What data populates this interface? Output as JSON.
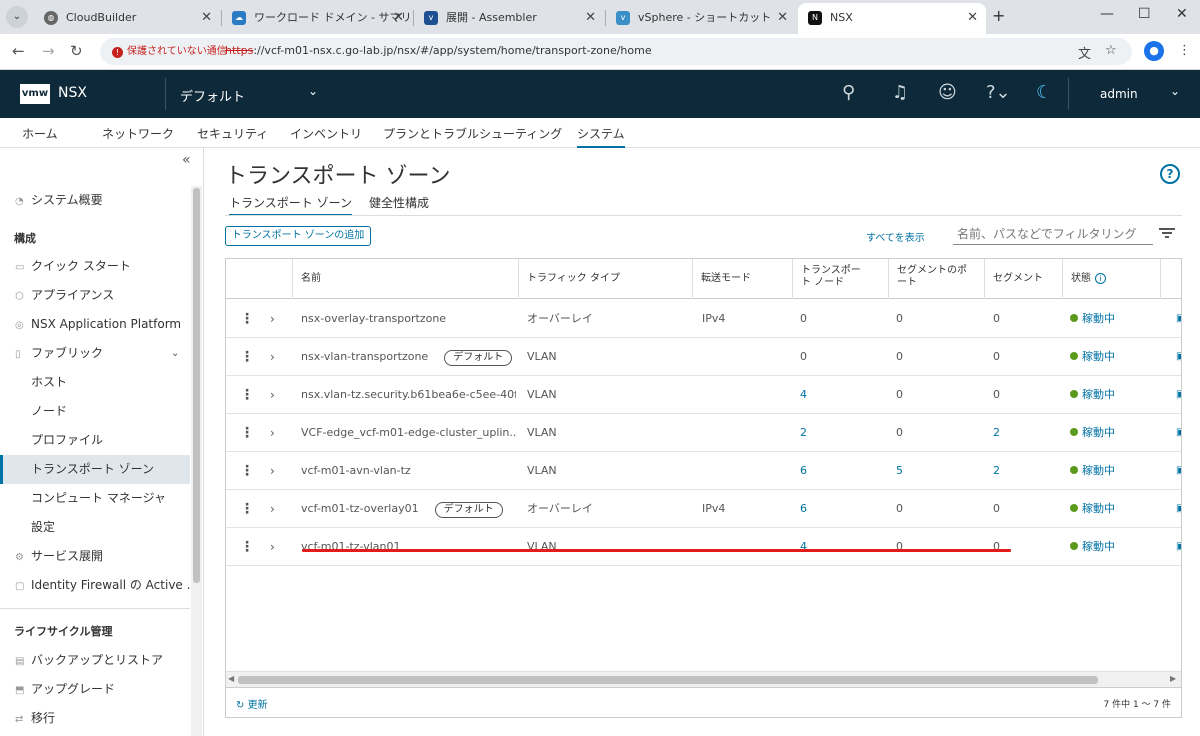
{
  "browser": {
    "tabs": [
      {
        "title": "CloudBuilder",
        "icon": "globe-icon"
      },
      {
        "title": "ワークロード ドメイン - サマリ",
        "icon": "cloud-icon"
      },
      {
        "title": "展開 - Assembler",
        "icon": "vmw-icon"
      },
      {
        "title": "vSphere - ショートカット",
        "icon": "vsphere-icon"
      },
      {
        "title": "NSX",
        "icon": "nsx-icon"
      }
    ],
    "new_tab": "+",
    "security_label": "保護されていない通信",
    "url_scheme": "https",
    "url_rest": "://vcf-m01-nsx.c.go-lab.jp/nsx/#/app/system/home/transport-zone/home"
  },
  "header": {
    "logo": "vmw",
    "app_name": "NSX",
    "context": "デフォルト",
    "user": "admin"
  },
  "menu": [
    "ホーム",
    "ネットワーク",
    "セキュリティ",
    "インベントリ",
    "プランとトラブルシューティング",
    "システム"
  ],
  "sidebar": {
    "overview": "システム概要",
    "config_header": "構成",
    "quick_start": "クイック スタート",
    "appliances": "アプライアンス",
    "nap": "NSX Application Platform",
    "fabric": "ファブリック",
    "fabric_items": [
      "ホスト",
      "ノード",
      "プロファイル",
      "トランスポート ゾーン",
      "コンピュート マネージャ",
      "設定"
    ],
    "service_deploy": "サービス展開",
    "idfw": "Identity Firewall の Active ...",
    "lifecycle_header": "ライフサイクル管理",
    "backup": "バックアップとリストア",
    "upgrade": "アップグレード",
    "migrate": "移行"
  },
  "page": {
    "title": "トランスポート ゾーン",
    "tabs": [
      "トランスポート ゾーン",
      "健全性構成"
    ],
    "add_button": "トランスポート ゾーンの追加",
    "show_all": "すべてを表示",
    "filter_placeholder": "名前、パスなどでフィルタリング",
    "refresh": "更新",
    "pagination": "7 件中 1 ～ 7 件"
  },
  "table": {
    "headers": [
      "名前",
      "トラフィック タイプ",
      "転送モード",
      "トランスポート ノード",
      "セグメントのポート",
      "セグメント",
      "状態"
    ],
    "default_badge": "デフォルト",
    "rows": [
      {
        "name": "nsx-overlay-transportzone",
        "type": "オーバーレイ",
        "mode": "IPv4",
        "nodes": "0",
        "ports": "0",
        "segments": "0",
        "status": "稼動中"
      },
      {
        "name": "nsx-vlan-transportzone",
        "type": "VLAN",
        "mode": "",
        "nodes": "0",
        "ports": "0",
        "segments": "0",
        "status": "稼動中"
      },
      {
        "name": "nsx.vlan-tz.security.b61bea6e-c5ee-40f...",
        "type": "VLAN",
        "mode": "",
        "nodes": "4",
        "ports": "0",
        "segments": "0",
        "status": "稼動中"
      },
      {
        "name": "VCF-edge_vcf-m01-edge-cluster_uplin...",
        "type": "VLAN",
        "mode": "",
        "nodes": "2",
        "ports": "0",
        "segments": "2",
        "status": "稼動中"
      },
      {
        "name": "vcf-m01-avn-vlan-tz",
        "type": "VLAN",
        "mode": "",
        "nodes": "6",
        "ports": "5",
        "segments": "2",
        "status": "稼動中"
      },
      {
        "name": "vcf-m01-tz-overlay01",
        "type": "オーバーレイ",
        "mode": "IPv4",
        "nodes": "6",
        "ports": "0",
        "segments": "0",
        "status": "稼動中"
      },
      {
        "name": "vcf-m01-tz-vlan01",
        "type": "VLAN",
        "mode": "",
        "nodes": "4",
        "ports": "0",
        "segments": "0",
        "status": "稼動中"
      }
    ]
  }
}
